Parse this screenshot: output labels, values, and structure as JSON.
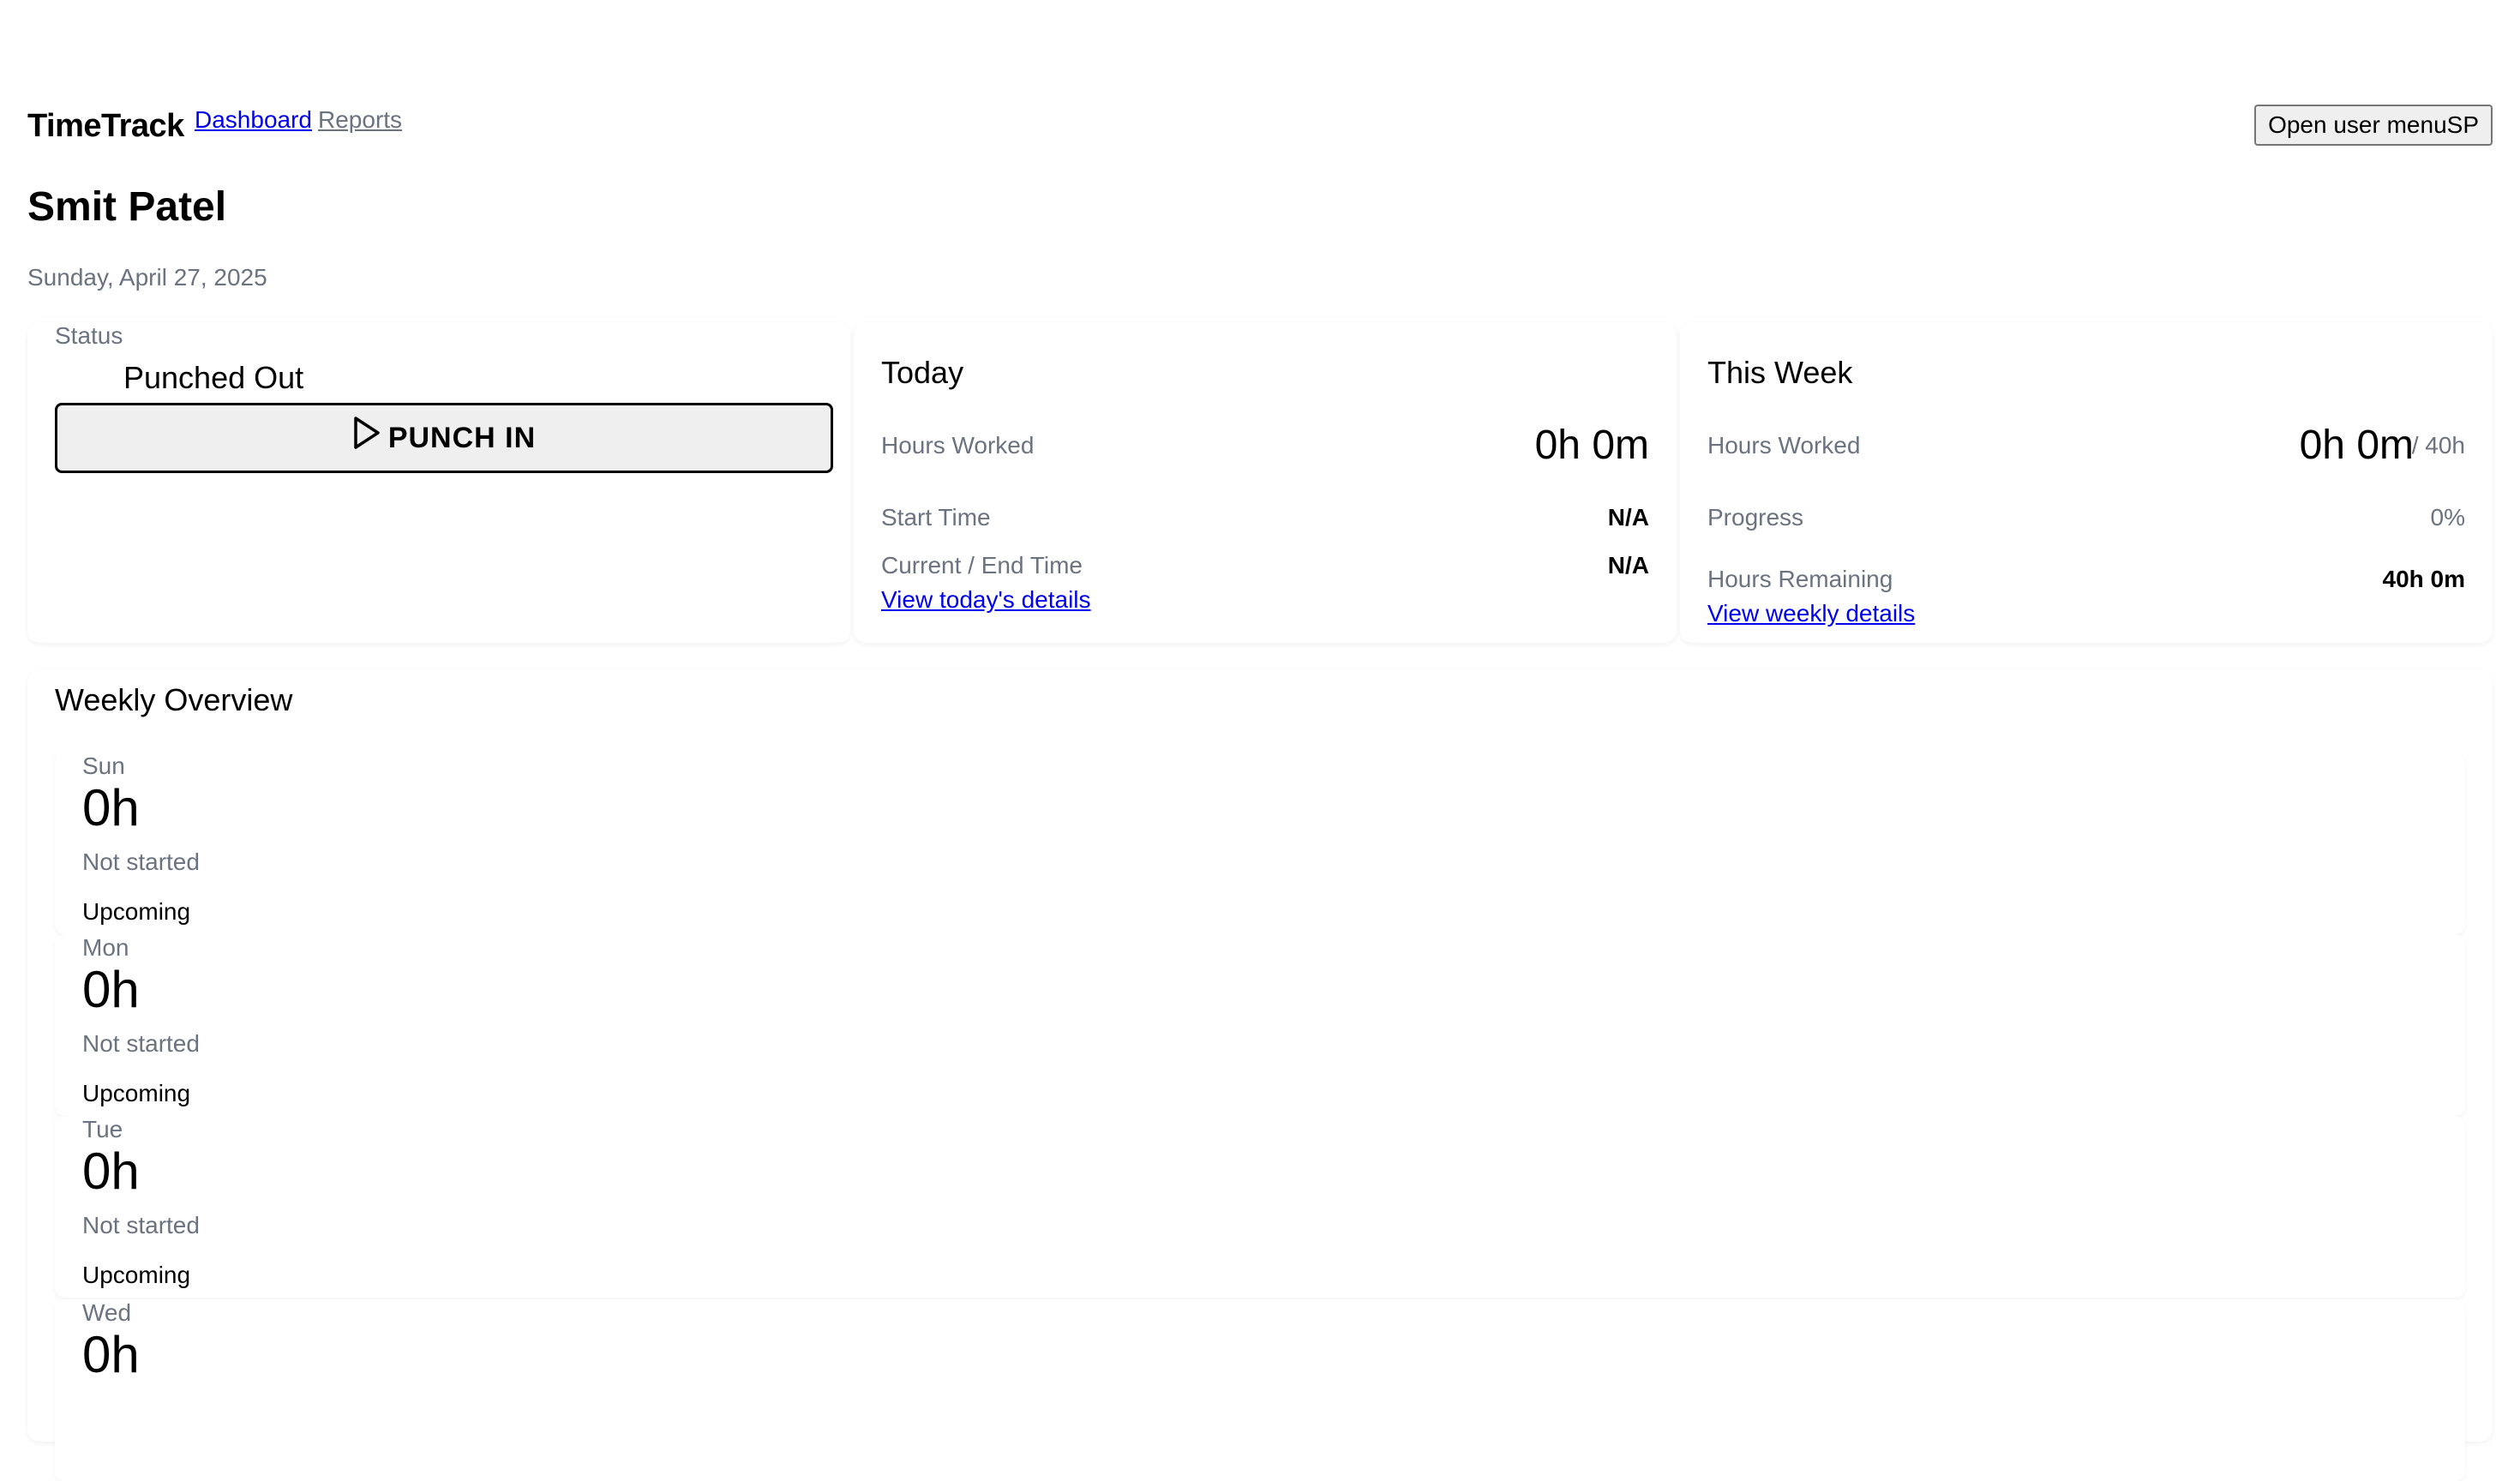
{
  "nav": {
    "brand": "TimeTrack",
    "links": [
      "Dashboard",
      "Reports"
    ],
    "user_menu_label": "Open user menuSP"
  },
  "user": {
    "name": "Smit Patel",
    "date": "Sunday, April 27, 2025"
  },
  "status_card": {
    "label": "Status",
    "status": "Punched Out",
    "button_label": "PUNCH IN",
    "button_icon": "play-icon"
  },
  "today_card": {
    "title": "Today",
    "hours_worked_label": "Hours Worked",
    "hours_worked": "0h 0m",
    "start_time_label": "Start Time",
    "start_time": "N/A",
    "end_time_label": "Current / End Time",
    "end_time": "N/A",
    "link": "View today's details"
  },
  "week_card": {
    "title": "This Week",
    "hours_worked_label": "Hours Worked",
    "hours_worked": "0h 0m",
    "hours_goal": "/ 40h",
    "progress_label": "Progress",
    "progress": "0%",
    "remaining_label": "Hours Remaining",
    "remaining": "40h 0m",
    "link": "View weekly details"
  },
  "overview": {
    "title": "Weekly Overview",
    "days": [
      {
        "name": "Sun",
        "hours": "0h",
        "note": "Not started",
        "state": "Upcoming"
      },
      {
        "name": "Mon",
        "hours": "0h",
        "note": "Not started",
        "state": "Upcoming"
      },
      {
        "name": "Tue",
        "hours": "0h",
        "note": "Not started",
        "state": "Upcoming"
      },
      {
        "name": "Wed",
        "hours": "0h"
      }
    ]
  }
}
